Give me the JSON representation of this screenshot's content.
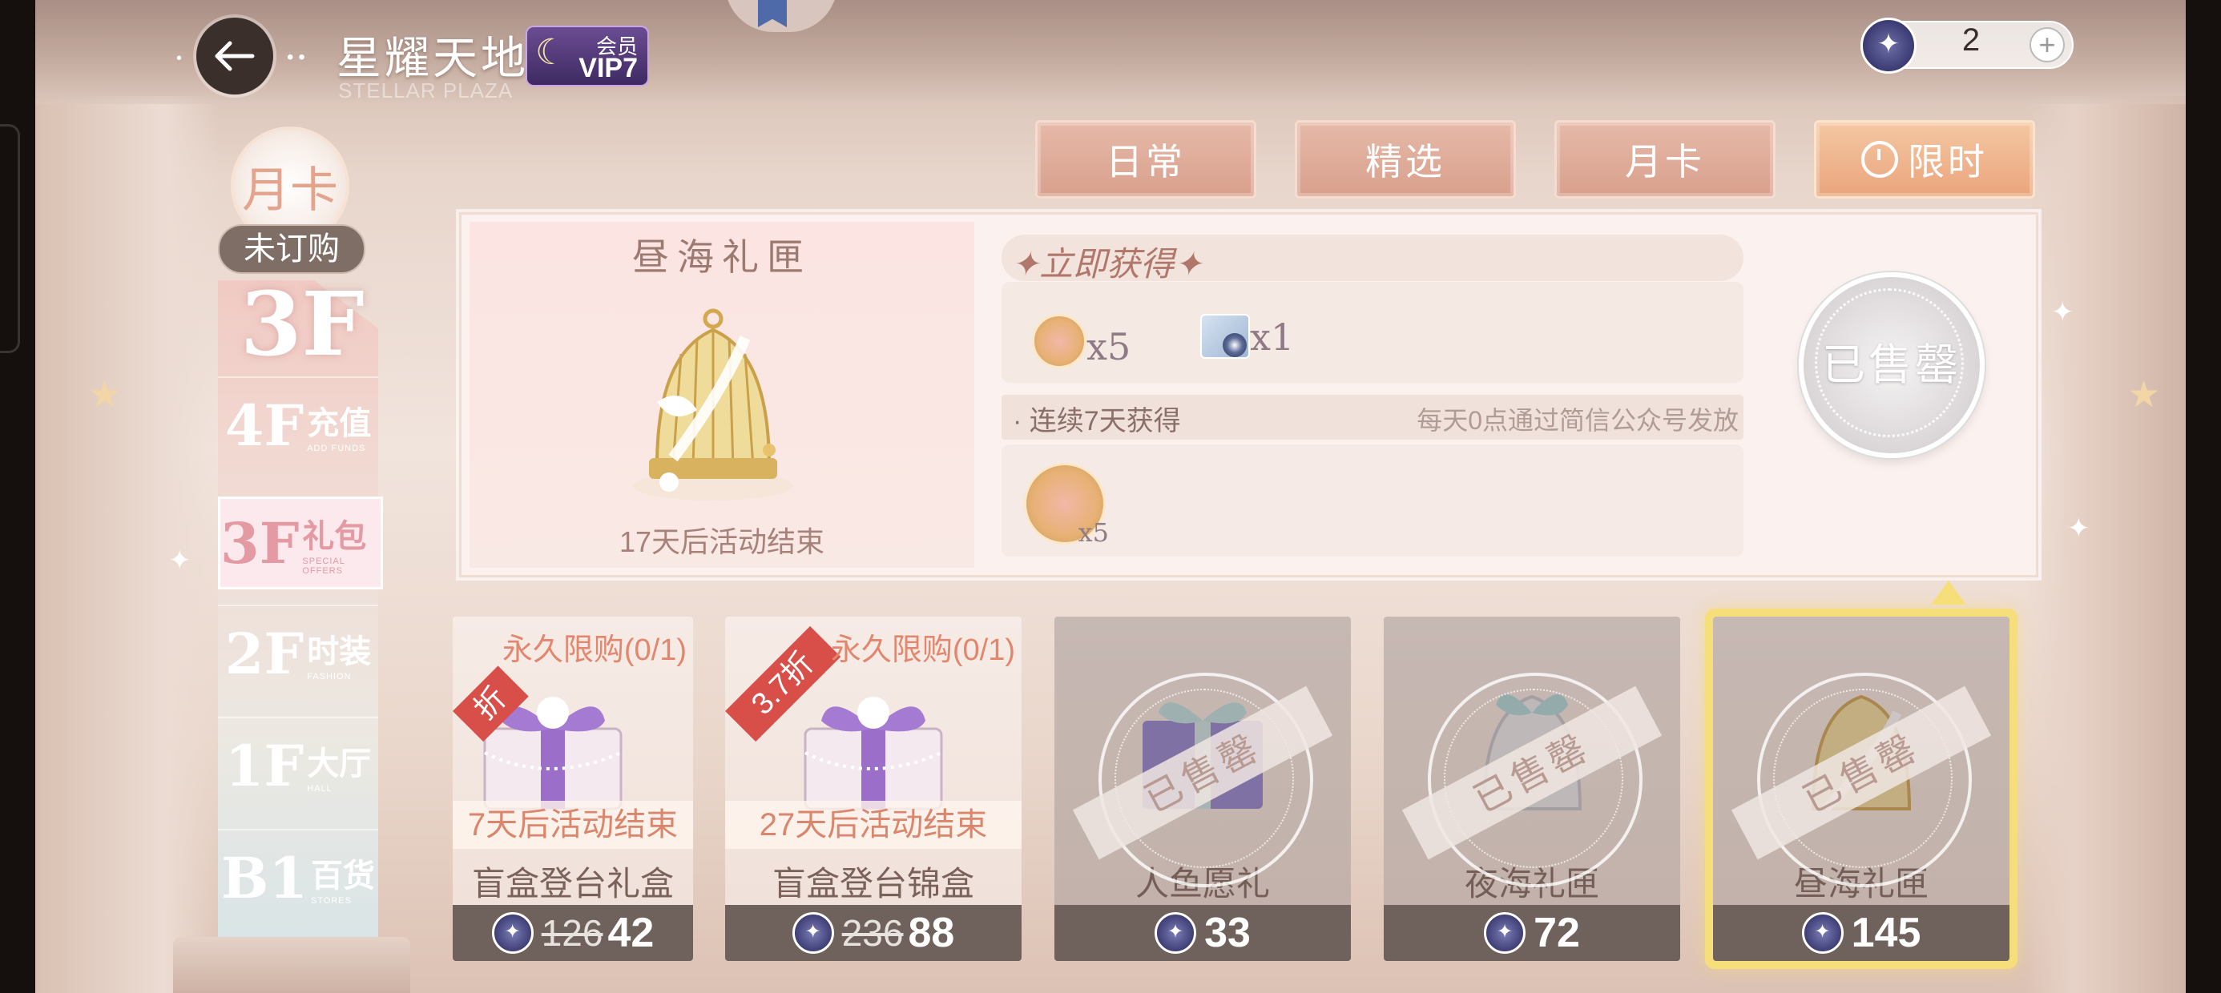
{
  "header": {
    "title": "星耀天地",
    "subtitle": "STELLAR PLAZA",
    "vip_label": "会员",
    "vip_level": "VIP7",
    "currency_value": "2",
    "plus": "+",
    "back_icon": "back-arrow-icon"
  },
  "categories": [
    {
      "label": "日常",
      "active": false
    },
    {
      "label": "精选",
      "active": false
    },
    {
      "label": "月卡",
      "active": false
    },
    {
      "label": "限时",
      "active": true
    }
  ],
  "sidebar": {
    "badge_label": "月卡",
    "status": "未订购",
    "current_floor": "3F",
    "floors": [
      {
        "num": "4F",
        "cn": "充值",
        "en": "ADD FUNDS"
      },
      {
        "num": "3F",
        "cn": "礼包",
        "en": "SPECIAL OFFERS"
      },
      {
        "num": "2F",
        "cn": "时装",
        "en": "FASHION"
      },
      {
        "num": "1F",
        "cn": "大厅",
        "en": "HALL"
      },
      {
        "num": "B1",
        "cn": "百货",
        "en": "STORES"
      }
    ]
  },
  "detail": {
    "title": "昼海礼匣",
    "countdown": "17天后活动结束",
    "get_now_label": "立即获得",
    "rewards_now": [
      {
        "icon": "gold-coin-icon",
        "qty": "x5"
      },
      {
        "icon": "contact-lens-icon",
        "qty": "x1"
      }
    ],
    "seven_days_label": "连续7天获得",
    "seven_days_note": "每天0点通过简信公众号发放",
    "rewards_daily": [
      {
        "icon": "gold-coin-icon",
        "qty": "x5"
      }
    ],
    "sold_out": "已售罄"
  },
  "cards": [
    {
      "name": "盲盒登台礼盒",
      "limit": "永久限购(0/1)",
      "ends": "7天后活动结束",
      "deal": "折",
      "old_price": "126",
      "price": "42",
      "sold": false
    },
    {
      "name": "盲盒登台锦盒",
      "limit": "永久限购(0/1)",
      "ends": "27天后活动结束",
      "deal": "3.7折",
      "old_price": "236",
      "price": "88",
      "sold": false
    },
    {
      "name": "人鱼愿礼",
      "sold_label": "已售罄",
      "price": "33",
      "sold": true
    },
    {
      "name": "夜海礼匣",
      "sold_label": "已售罄",
      "price": "72",
      "sold": true
    },
    {
      "name": "昼海礼匣",
      "sold_label": "已售罄",
      "price": "145",
      "sold": true,
      "selected": true
    }
  ],
  "colors": {
    "accent": "#e3866e",
    "tab": "#d9a08d",
    "tab_active": "#eaa57d",
    "price_bar": "#6f625d",
    "selected_border": "#f6df7a"
  }
}
